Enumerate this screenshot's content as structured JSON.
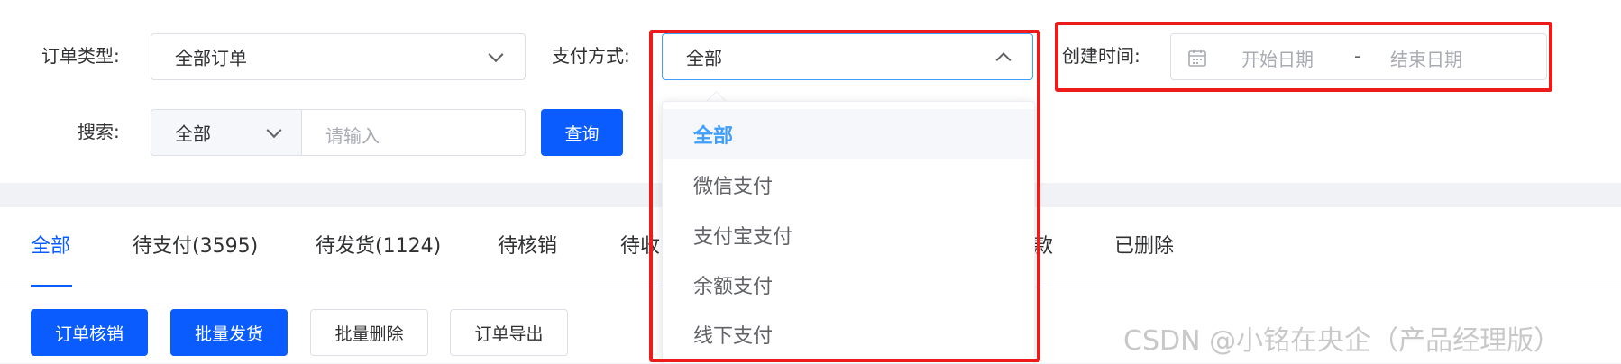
{
  "filters": {
    "order_type": {
      "label": "订单类型:",
      "value": "全部订单"
    },
    "payment": {
      "label": "支付方式:",
      "value": "全部"
    },
    "created_time": {
      "label": "创建时间:",
      "start_placeholder": "开始日期",
      "separator": "-",
      "end_placeholder": "结束日期"
    },
    "search": {
      "label": "搜索:",
      "field_value": "全部",
      "placeholder": "请输入",
      "query_label": "查询"
    }
  },
  "tabs": [
    {
      "label": "全部",
      "active": true
    },
    {
      "label": "待支付(3595)"
    },
    {
      "label": "待发货(1124)"
    },
    {
      "label": "待核销"
    },
    {
      "label": "待收"
    },
    {
      "label": "款"
    },
    {
      "label": "已删除"
    }
  ],
  "actions": {
    "verify": "订单核销",
    "batch_ship": "批量发货",
    "batch_delete": "批量删除",
    "export": "订单导出"
  },
  "payment_dropdown": {
    "options": [
      "全部",
      "微信支付",
      "支付宝支付",
      "余额支付",
      "线下支付"
    ],
    "selected": "全部"
  },
  "watermark": "CSDN @小铭在央企（产品经理版）",
  "colors": {
    "primary": "#0a5cff",
    "selected_option": "#409eff",
    "highlight_box": "#ee1b1b"
  },
  "icons": [
    "chevron-down-icon",
    "chevron-up-icon",
    "calendar-icon"
  ]
}
